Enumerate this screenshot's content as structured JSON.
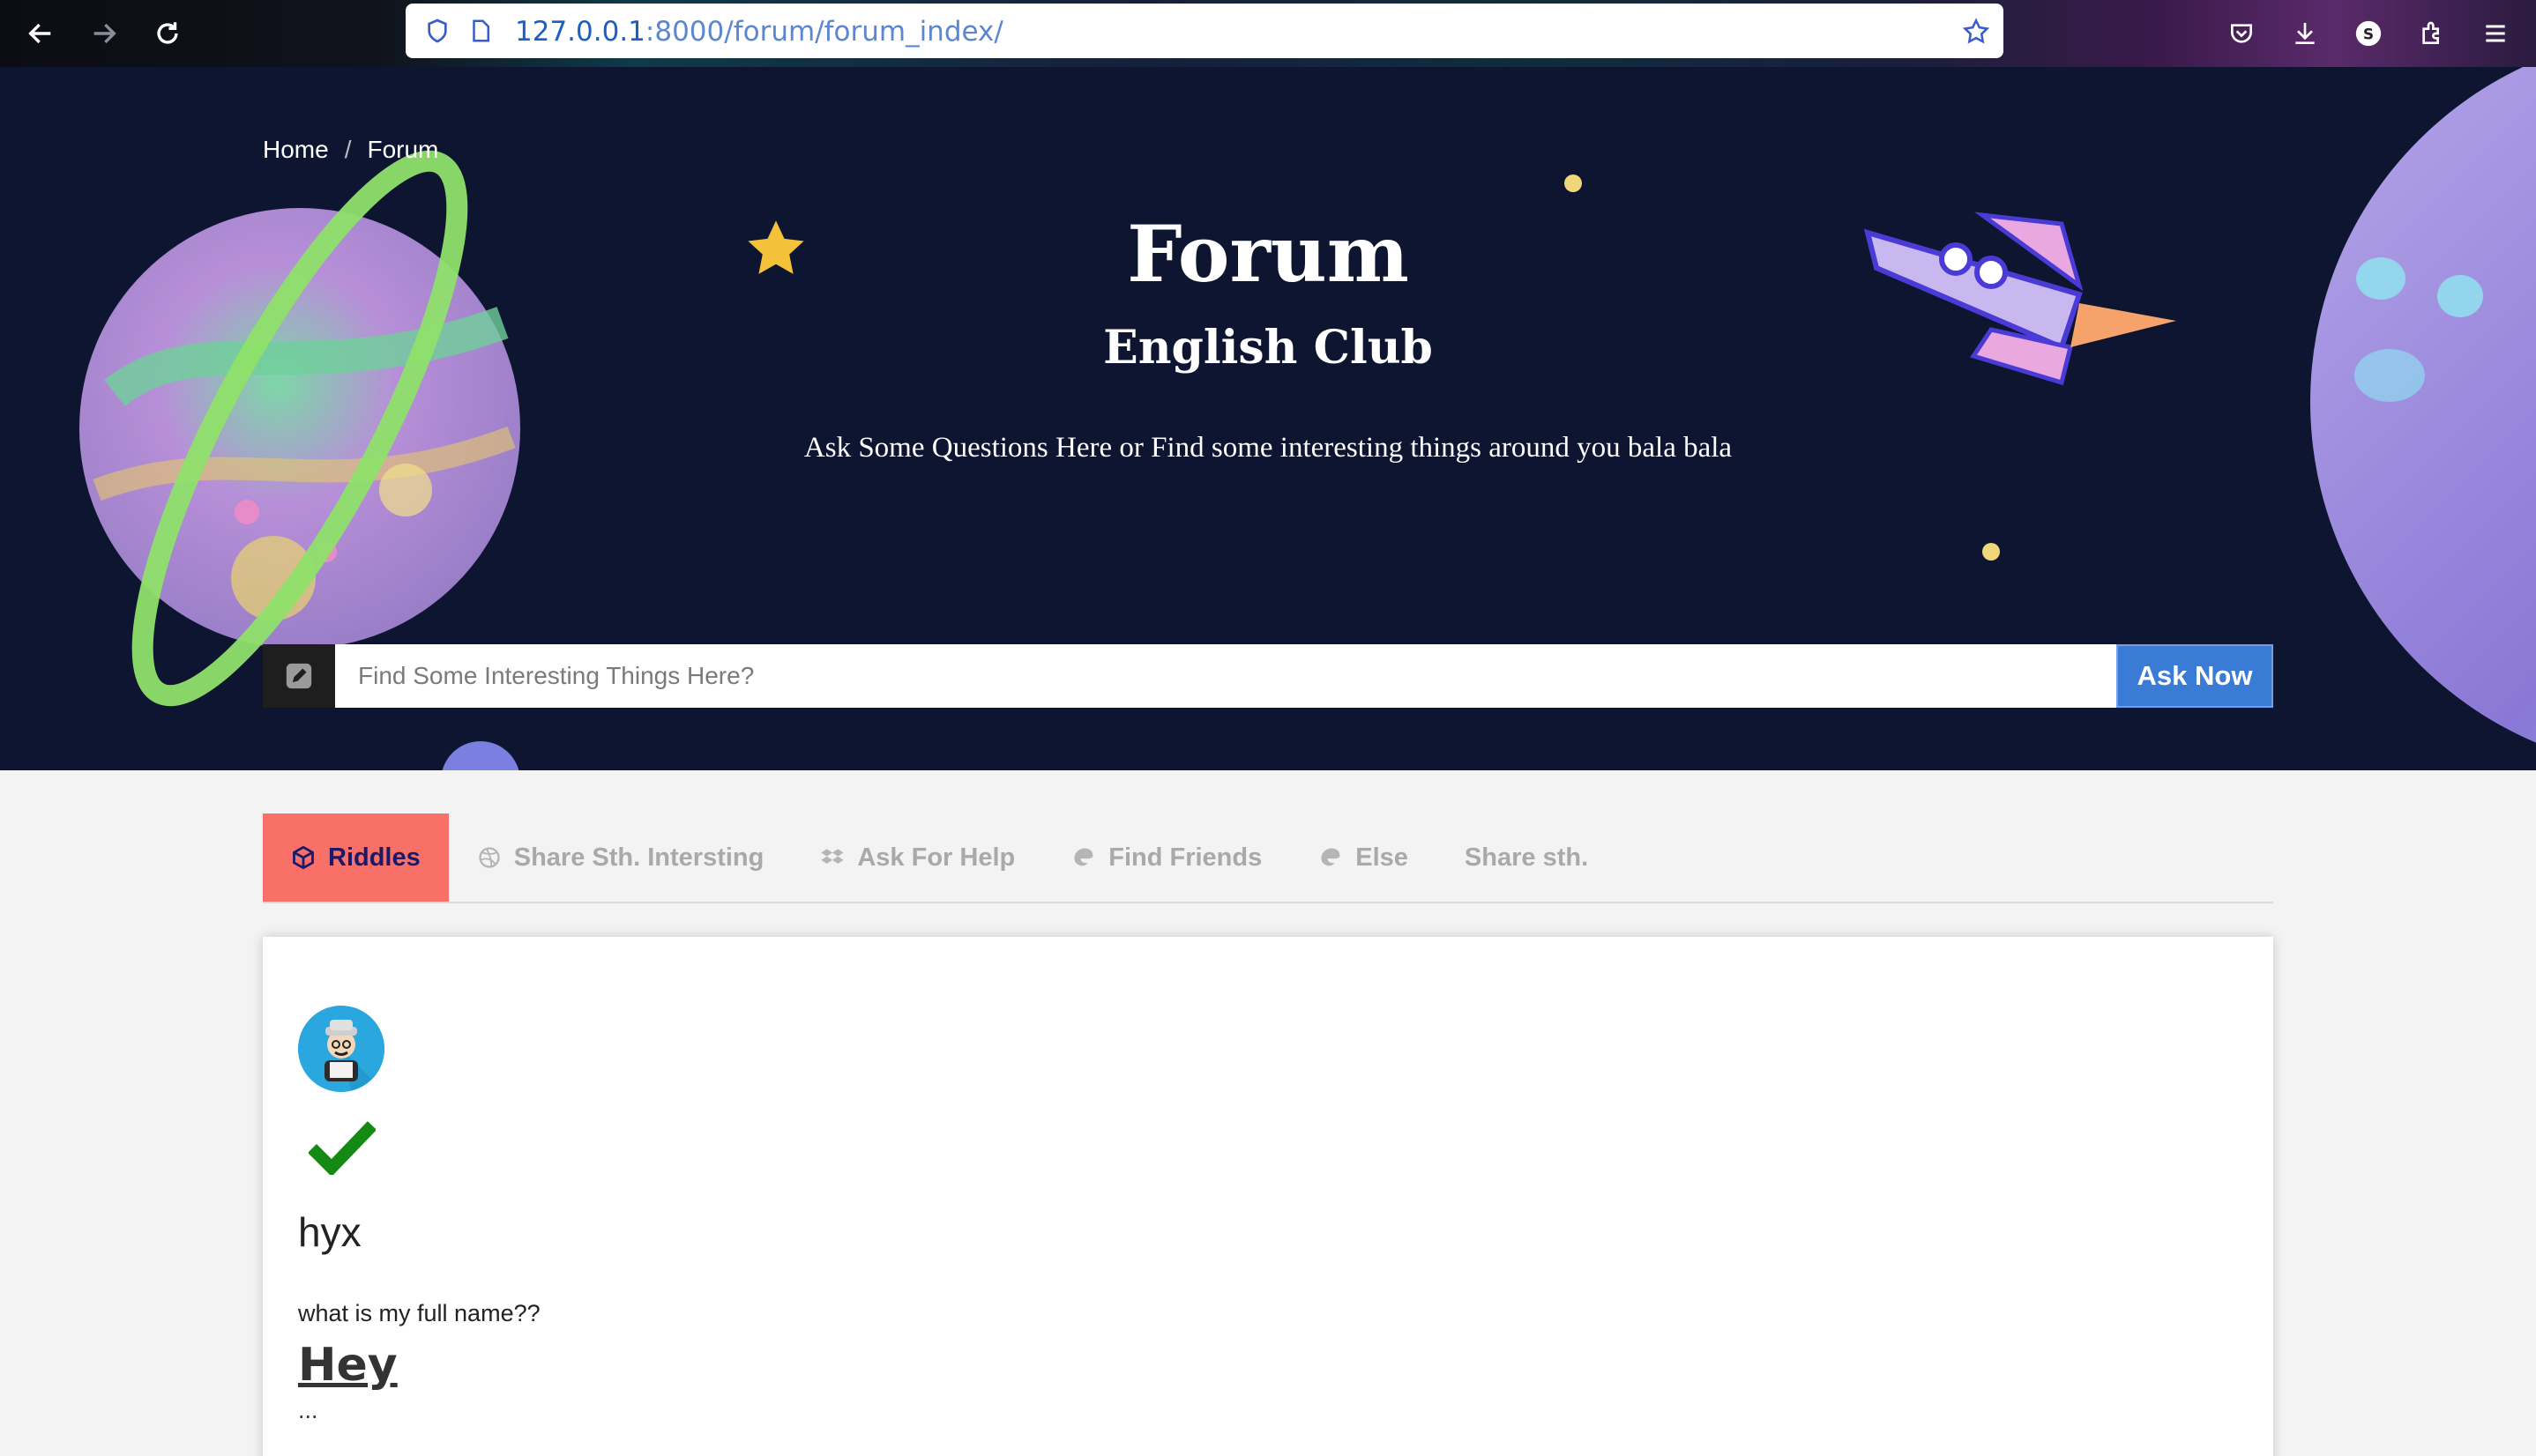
{
  "browser": {
    "url_host": "127.0.0.1",
    "url_rest": ":8000/forum/forum_index/"
  },
  "breadcrumb": {
    "home": "Home",
    "separator": "/",
    "current": "Forum"
  },
  "hero": {
    "title": "Forum",
    "subtitle": "English Club",
    "description": "Ask Some Questions Here or Find some interesting things around you bala bala"
  },
  "search": {
    "placeholder": "Find Some Interesting Things Here?",
    "button_label": "Ask Now"
  },
  "tabs": [
    {
      "label": "Riddles",
      "icon": "cube-icon",
      "active": true
    },
    {
      "label": "Share Sth. Intersting",
      "icon": "dribbble-icon",
      "active": false
    },
    {
      "label": "Ask For Help",
      "icon": "dropbox-icon",
      "active": false
    },
    {
      "label": "Find Friends",
      "icon": "edge-icon",
      "active": false
    },
    {
      "label": "Else",
      "icon": "edge-icon",
      "active": false
    },
    {
      "label": "Share sth.",
      "icon": "",
      "active": false
    }
  ],
  "post": {
    "username": "hyx",
    "question": "what is my full name??",
    "heading": "Hey",
    "ellipsis": "..."
  },
  "colors": {
    "hero_bg": "#0d1530",
    "active_tab_bg": "#f97068",
    "ask_button": "#3a7bd5",
    "check_green": "#1a8a1a"
  }
}
